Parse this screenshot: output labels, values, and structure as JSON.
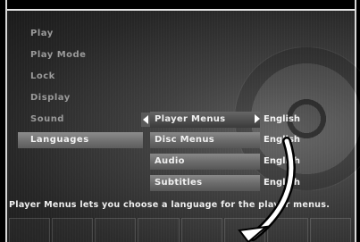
{
  "sidebar": {
    "items": [
      {
        "label": "Play"
      },
      {
        "label": "Play Mode"
      },
      {
        "label": "Lock"
      },
      {
        "label": "Display"
      },
      {
        "label": "Sound"
      },
      {
        "label": "Languages"
      }
    ]
  },
  "submenu": {
    "items": [
      {
        "label": "Player Menus",
        "value": "English"
      },
      {
        "label": "Disc Menus",
        "value": "English"
      },
      {
        "label": "Audio",
        "value": "English"
      },
      {
        "label": "Subtitles",
        "value": "English"
      }
    ]
  },
  "description": "Player Menus lets you choose a language for the player menus.",
  "icons": {
    "left_arrow": "left-triangle-icon",
    "right_arrow": "right-triangle-icon",
    "cursor": "curved-arrow-icon"
  },
  "colors": {
    "highlight": "#7a7a7a",
    "text": "#f0f0f0",
    "dim_text": "#9a9a9a"
  }
}
